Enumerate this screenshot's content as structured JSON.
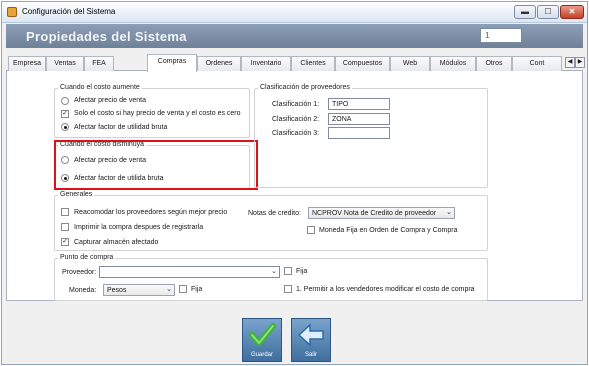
{
  "window": {
    "title": "Configuración del Sistema",
    "controls": {
      "minimize": "▬",
      "maximize": "☐",
      "close": "✕"
    }
  },
  "header": {
    "title": "Propiedades del Sistema",
    "field_value": "1"
  },
  "tabs": [
    "Empresa",
    "Ventas",
    "FEA",
    "Compras",
    "Ordenes",
    "Inventario",
    "Clientes",
    "Compuestos",
    "Web",
    "Módulos",
    "Otros",
    "Cont"
  ],
  "active_tab": "Compras",
  "tab_scroll": {
    "left": "◀",
    "right": "▶"
  },
  "costo_aumente": {
    "title": "Cuando el costo aumente",
    "options": [
      {
        "type": "radio",
        "label": "Afectar precio de venta",
        "checked": false
      },
      {
        "type": "checkbox",
        "label": "Solo el costo si hay precio de venta y el costo es cero",
        "checked": true
      },
      {
        "type": "radio",
        "label": "Afectar factor de utilidad bruta",
        "checked": true
      }
    ]
  },
  "costo_disminuya": {
    "title": "Cuando el costo disminuya",
    "options": [
      {
        "label": "Afectar precio de venta",
        "checked": false
      },
      {
        "label": "Afectar factor de utilida bruta",
        "checked": true
      }
    ]
  },
  "clasificacion": {
    "title": "Clasificación de proveedores",
    "rows": [
      {
        "label": "Clasificación 1:",
        "value": "TIPO"
      },
      {
        "label": "Clasificación 2:",
        "value": "ZONA"
      },
      {
        "label": "Clasificación 3:",
        "value": ""
      }
    ]
  },
  "generales": {
    "title": "Generales",
    "checks": [
      {
        "label": "Reacomodar los proveedores según mejor precio",
        "checked": false
      },
      {
        "label": "Imprimir la compra despues de registrarla",
        "checked": false
      },
      {
        "label": "Capturar almacén afectado",
        "checked": true
      }
    ],
    "notas_label": "Notas de credito:",
    "notas_value": "NCPROV Nota de Credito de proveedor",
    "moneda_fija": {
      "label": "Moneda Fija en Orden de Compra y Compra",
      "checked": false
    }
  },
  "punto_compra": {
    "title": "Punto de compra",
    "proveedor_label": "Proveedor:",
    "proveedor_value": "",
    "fija_label": "Fija",
    "moneda_label": "Moneda:",
    "moneda_value": "Pesos",
    "fija2_label": "Fija",
    "permitir_label": "1. Permitir a los vendedores modificar el costo de compra"
  },
  "buttons": {
    "guardar": "Guardar",
    "salir": "Salir"
  },
  "combo_arrow": "⌄",
  "colors": {
    "highlight_box": "#d9121b",
    "header_band": "#7a8da4",
    "button_blue": "#4f7fb0",
    "save_green": "#3fb23a"
  }
}
